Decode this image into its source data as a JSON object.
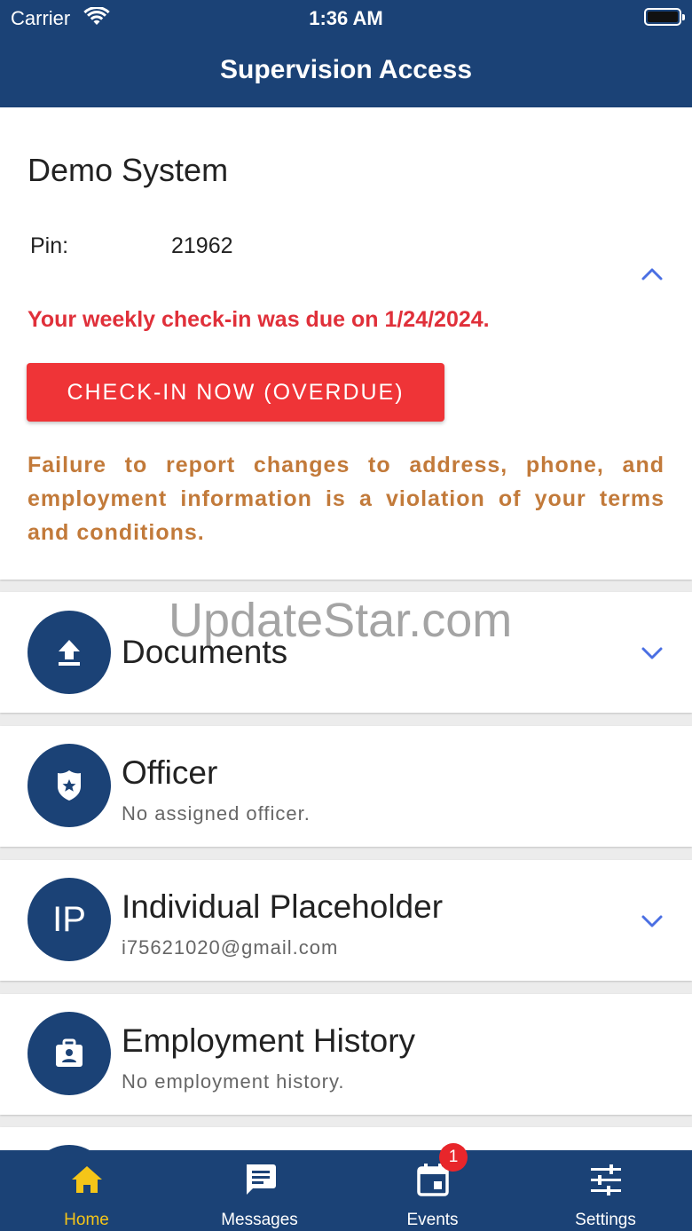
{
  "status_bar": {
    "carrier": "Carrier",
    "time": "1:36 AM"
  },
  "header": {
    "title": "Supervision Access"
  },
  "system": {
    "name": "Demo System",
    "pin_label": "Pin:",
    "pin_value": "21962",
    "due_message": "Your weekly check-in was due on 1/24/2024.",
    "checkin_button": "CHECK-IN NOW (OVERDUE)",
    "warning": "Failure to report changes to address, phone, and employment information is a violation of your terms and conditions."
  },
  "documents": {
    "title": "Documents"
  },
  "officer": {
    "title": "Officer",
    "subtitle": "No assigned officer."
  },
  "individual": {
    "initials": "IP",
    "title": "Individual Placeholder",
    "subtitle": "i75621020@gmail.com"
  },
  "employment": {
    "title": "Employment History",
    "subtitle": "No employment history."
  },
  "watermark": "UpdateStar.com",
  "tabs": [
    {
      "label": "Home",
      "icon": "home-icon",
      "active": true
    },
    {
      "label": "Messages",
      "icon": "message-icon",
      "active": false
    },
    {
      "label": "Events",
      "icon": "calendar-icon",
      "active": false,
      "badge": "1"
    },
    {
      "label": "Settings",
      "icon": "sliders-icon",
      "active": false
    }
  ],
  "colors": {
    "header": "#1b4276",
    "alert_red": "#e0303a",
    "button_red": "#ef3437",
    "warning_orange": "#c27a3a",
    "active_tab": "#f5c518",
    "chevron": "#4a6fe3"
  }
}
